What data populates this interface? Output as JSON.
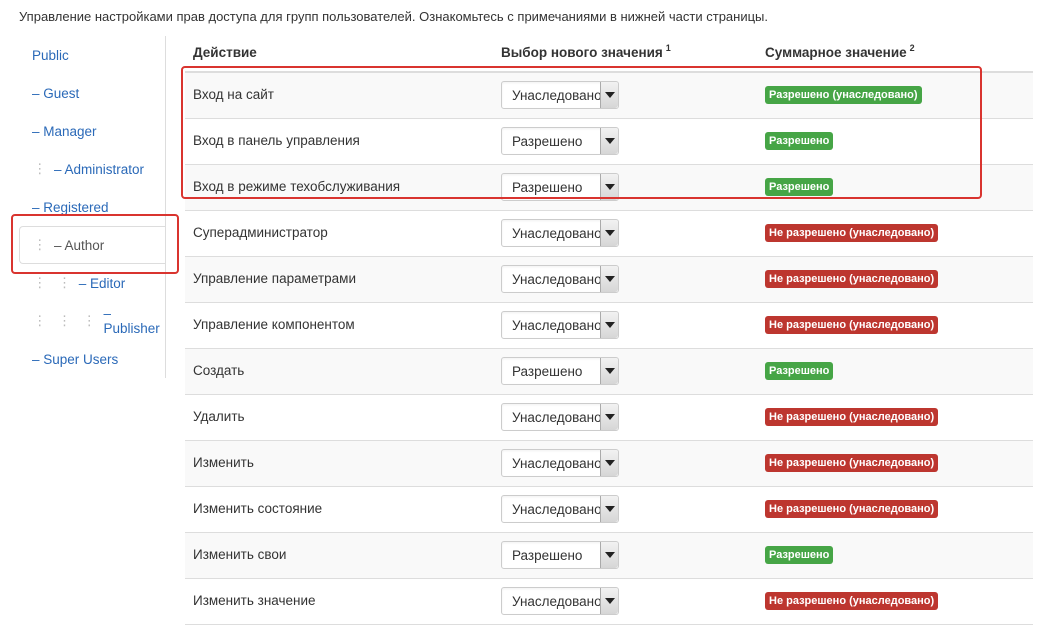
{
  "intro": "Управление настройками прав доступа для групп пользователей. Ознакомьтесь с примечаниями в нижней части страницы.",
  "sidebar": {
    "items": [
      {
        "label": "Public",
        "depth": 0
      },
      {
        "label": "– Guest",
        "depth": 1
      },
      {
        "label": "– Manager",
        "depth": 1
      },
      {
        "label": "– Administrator",
        "depth": 2
      },
      {
        "label": "– Registered",
        "depth": 1
      },
      {
        "label": "– Author",
        "depth": 2,
        "active": true
      },
      {
        "label": "– Editor",
        "depth": 3
      },
      {
        "label": "– Publisher",
        "depth": 4
      },
      {
        "label": "– Super Users",
        "depth": 1
      }
    ]
  },
  "table": {
    "headers": {
      "action": "Действие",
      "select": "Выбор нового значения",
      "select_note": "1",
      "result": "Суммарное значение",
      "result_note": "2"
    },
    "rows": [
      {
        "action": "Вход на сайт",
        "value": "Унаследовано",
        "result": "Разрешено (унаследовано)",
        "result_color": "green"
      },
      {
        "action": "Вход в панель управления",
        "value": "Разрешено",
        "result": "Разрешено",
        "result_color": "green"
      },
      {
        "action": "Вход в режиме техобслуживания",
        "value": "Разрешено",
        "result": "Разрешено",
        "result_color": "green"
      },
      {
        "action": "Суперадминистратор",
        "value": "Унаследовано",
        "result": "Не разрешено (унаследовано)",
        "result_color": "red"
      },
      {
        "action": "Управление параметрами",
        "value": "Унаследовано",
        "result": "Не разрешено (унаследовано)",
        "result_color": "red"
      },
      {
        "action": "Управление компонентом",
        "value": "Унаследовано",
        "result": "Не разрешено (унаследовано)",
        "result_color": "red"
      },
      {
        "action": "Создать",
        "value": "Разрешено",
        "result": "Разрешено",
        "result_color": "green"
      },
      {
        "action": "Удалить",
        "value": "Унаследовано",
        "result": "Не разрешено (унаследовано)",
        "result_color": "red"
      },
      {
        "action": "Изменить",
        "value": "Унаследовано",
        "result": "Не разрешено (унаследовано)",
        "result_color": "red"
      },
      {
        "action": "Изменить состояние",
        "value": "Унаследовано",
        "result": "Не разрешено (унаследовано)",
        "result_color": "red"
      },
      {
        "action": "Изменить свои",
        "value": "Разрешено",
        "result": "Разрешено",
        "result_color": "green"
      },
      {
        "action": "Изменить значение",
        "value": "Унаследовано",
        "result": "Не разрешено (унаследовано)",
        "result_color": "red"
      }
    ]
  },
  "colors": {
    "link": "#2a69b8",
    "allowed": "#46a546",
    "denied": "#bd362f",
    "highlight": "#d9342f"
  }
}
